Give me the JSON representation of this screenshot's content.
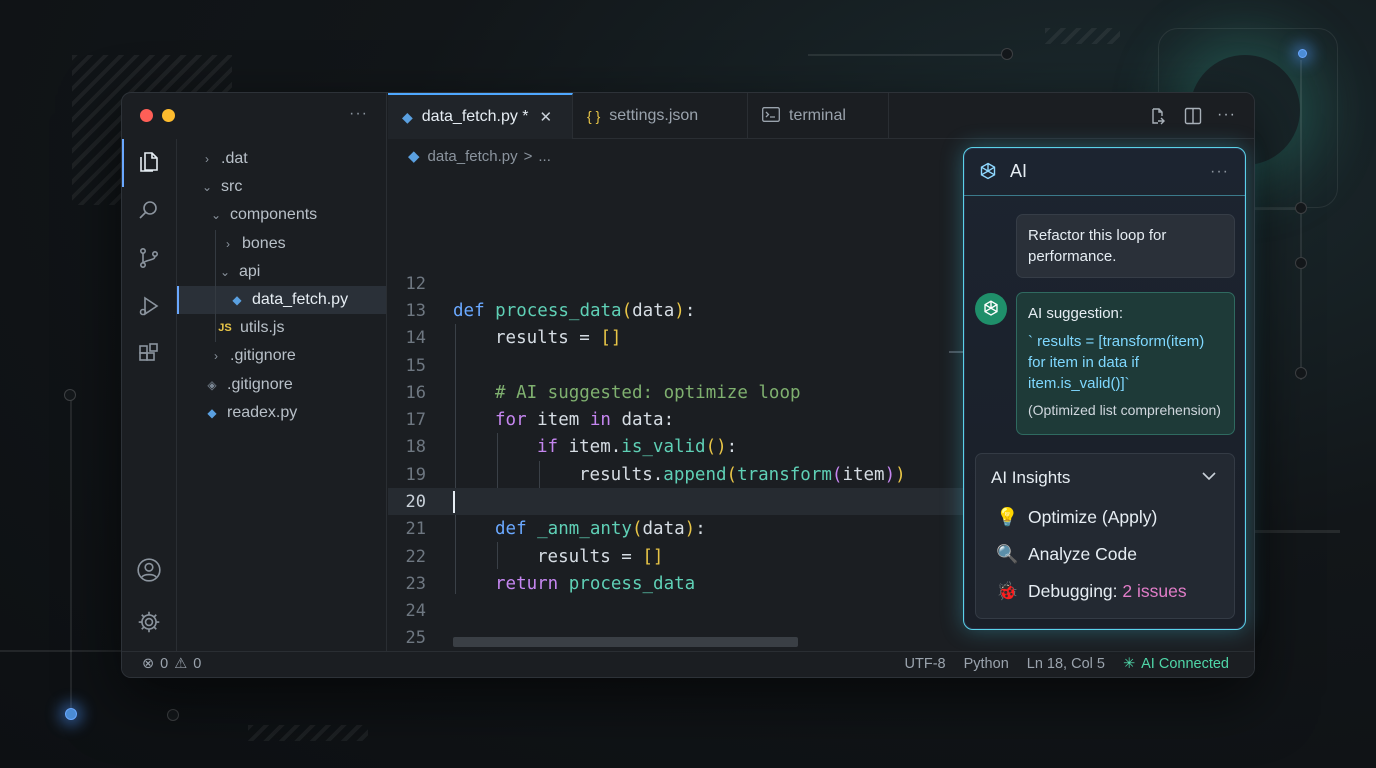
{
  "window": {
    "traffic_lights": [
      "close",
      "minimize",
      "maximize"
    ]
  },
  "activity_bar": {
    "items": [
      "explorer-icon",
      "search-icon",
      "source-control-icon",
      "run-debug-icon",
      "extensions-icon"
    ],
    "bottom": [
      "account-icon",
      "settings-gear-icon"
    ]
  },
  "sidebar": {
    "more": "···",
    "tree": [
      {
        "label": ".dat",
        "type": "folder",
        "expanded": false
      },
      {
        "label": "src",
        "type": "folder",
        "expanded": true
      },
      {
        "label": "components",
        "type": "folder",
        "expanded": true
      },
      {
        "label": "bones",
        "type": "folder",
        "expanded": false
      },
      {
        "label": "api",
        "type": "folder",
        "expanded": true
      },
      {
        "label": "data_fetch.py",
        "type": "python",
        "selected": true
      },
      {
        "label": "utils.js",
        "type": "javascript",
        "icon_text": "JS"
      },
      {
        "label": ".gitignore",
        "type": "folder",
        "expanded": false
      },
      {
        "label": ".gitignore",
        "type": "git"
      },
      {
        "label": "readex.py",
        "type": "python"
      }
    ]
  },
  "tabs": [
    {
      "label": "data_fetch.py *",
      "icon": "python-icon",
      "active": true,
      "close": "✕"
    },
    {
      "label": "settings.json",
      "icon": "braces-icon",
      "icon_text": "{ }",
      "active": false
    },
    {
      "label": "terminal",
      "icon": "terminal-icon",
      "active": false
    }
  ],
  "tab_actions": [
    "compare-icon",
    "split-editor-icon",
    "more-icon"
  ],
  "breadcrumb": {
    "file": "data_fetch.py",
    "separator": ">",
    "rest": "..."
  },
  "editor": {
    "current_line": 20,
    "lines": [
      {
        "n": "12"
      },
      {
        "n": "13"
      },
      {
        "n": "14"
      },
      {
        "n": "15"
      },
      {
        "n": "16"
      },
      {
        "n": "17"
      },
      {
        "n": "18"
      },
      {
        "n": "19"
      },
      {
        "n": "20"
      },
      {
        "n": "21"
      },
      {
        "n": "22"
      },
      {
        "n": "23"
      },
      {
        "n": "24"
      },
      {
        "n": "25"
      }
    ],
    "code": {
      "l13_kw": "def",
      "l13_fn": "process_data",
      "l13_arg": "data",
      "l14": "results = ",
      "l14_br": "[]",
      "l16": "# AI suggested: optimize loop",
      "l17_kw1": "for",
      "l17_a": " item ",
      "l17_kw2": "in",
      "l17_b": " data:",
      "l18_kw": "if",
      "l18_a": " item.",
      "l18_fn": "is_valid",
      "l18_br": "()",
      "l18_b": ":",
      "l19_a": "results.",
      "l19_fn1": "append",
      "l19_fn2": "transform",
      "l19_arg": "item",
      "l21_kw": "def",
      "l21_fn": " _anm_anty",
      "l21_arg": "data",
      "l22": "results = ",
      "l22_br": "[]",
      "l23_kw": "return",
      "l23_fn": " process_data"
    }
  },
  "ai_panel": {
    "title": "AI",
    "more": "···",
    "user_message": "Refactor this loop for performance.",
    "ai_message": {
      "heading": "AI suggestion:",
      "code": "` results = [transform(item) for item in data if item.is_valid()]`",
      "note": "(Optimized list comprehension)"
    },
    "insights": {
      "title": "AI Insights",
      "items": [
        {
          "icon": "lightbulb-icon",
          "glyph": "💡",
          "label": "Optimize (Apply)"
        },
        {
          "icon": "magnifier-icon",
          "glyph": "🔍",
          "label": "Analyze Code"
        },
        {
          "icon": "bug-icon",
          "glyph": "🐞",
          "label": "Debugging: ",
          "highlight": "2 issues"
        }
      ]
    }
  },
  "statusbar": {
    "errors": "0",
    "warnings": "0",
    "encoding": "UTF-8",
    "language": "Python",
    "position": "Ln 18, Col 5",
    "ai_status": "AI Connected"
  },
  "colors": {
    "accent": "#6aa8ff",
    "ai_border": "#5ad2e8",
    "ai_green": "#4fd6a8",
    "keyword": "#c586f0",
    "function": "#5fd0b6",
    "comment": "#7fb06f"
  }
}
